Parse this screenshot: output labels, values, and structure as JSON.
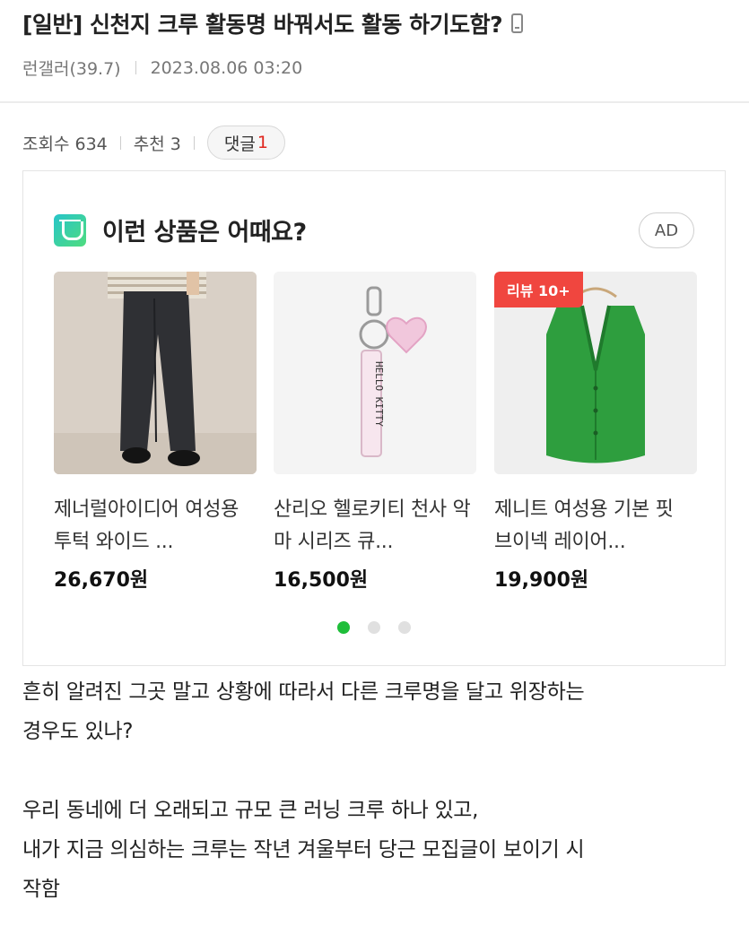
{
  "post": {
    "title": "[일반] 신천지 크루 활동명 바꿔서도 활동 하기도함?",
    "author": "런갤러(39.7)",
    "datetime": "2023.08.06 03:20",
    "views_label": "조회수 634",
    "likes_label": "추천 3",
    "comments_label": "댓글",
    "comments_count": "1"
  },
  "ad": {
    "heading": "이런 상품은 어때요?",
    "badge": "AD",
    "products": [
      {
        "name": "제너럴아이디어 여성용 투턱 와이드 ...",
        "price": "26,670",
        "unit": "원"
      },
      {
        "name": "산리오 헬로키티 천사 악마 시리즈 큐...",
        "price": "16,500",
        "unit": "원",
        "keychain_text": "HELLO KITTY"
      },
      {
        "name": "제니트 여성용 기본 핏 브이넥 레이어...",
        "price": "19,900",
        "unit": "원",
        "badge": "리뷰 10+"
      }
    ],
    "pagination": {
      "total": 3,
      "active": 1
    }
  },
  "body": {
    "lines": [
      "흔히 알려진 그곳 말고 상황에 따라서 다른 크루명을 달고 위장하는",
      "경우도 있나?",
      "",
      "우리 동네에 더 오래되고 규모 큰 러닝 크루 하나 있고,",
      "내가 지금 의심하는 크루는 작년 겨울부터 당근 모집글이 보이기 시",
      "작함"
    ]
  },
  "colors": {
    "accent_red": "#e0261e",
    "review_badge": "#f0463f",
    "pagination_active": "#1fbe3a",
    "text": "#222222"
  }
}
